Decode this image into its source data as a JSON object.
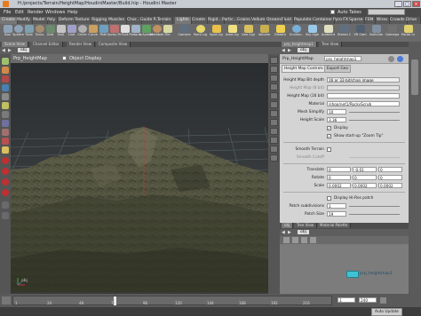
{
  "window": {
    "title": "Houdini Master",
    "title_path": "H:/projects/Terrain/HeightMap/HoudiniMaster/Build.hip - Houdini Master",
    "minimize": "_",
    "maximize": "□",
    "close": "×",
    "auto_takes": "Auto Takes"
  },
  "menubar": {
    "items": [
      "File",
      "Edit",
      "Render",
      "Windows",
      "Help"
    ]
  },
  "shelf": {
    "left_tabs": [
      "Create",
      "Modify",
      "Model",
      "Poly",
      "Deform",
      "Texture",
      "Rigging",
      "Muscles",
      "Char...",
      "Guide P...",
      "Terrain FX"
    ],
    "right_tabs": [
      "Lights",
      "Create",
      "Rigid...",
      "Partic...",
      "Grains",
      "Vellum",
      "Oceans",
      "Fluid",
      "Populate",
      "Container",
      "Pyro FX",
      "Sparse",
      "FEM",
      "Wires",
      "Crowds",
      "Drive"
    ],
    "left_tools": [
      "Box",
      "Sphere",
      "Tube",
      "Torus",
      "Grid",
      "Null",
      "Line",
      "Circle",
      "Curve",
      "Path",
      "Spray Paint",
      "Font",
      "Platonic",
      "L-System",
      "Metaball",
      "File"
    ],
    "right_tools": [
      "Camera",
      "Point Light",
      "Spot Light",
      "Area Light",
      "Geo Light",
      "Volume",
      "Distant",
      "Environ.",
      "Sky Light",
      "Ambient",
      "Stereo Cam",
      "VR Cam",
      "Switcher",
      "Gamepad",
      "Portal Light"
    ]
  },
  "left_pane": {
    "tabs": [
      "Scene View",
      "Channel Editor",
      "Render View",
      "Composite View"
    ],
    "path": "obj",
    "node_name": "Prp_HeightMap",
    "object_display": "Object Display",
    "node_label": "obj"
  },
  "params": {
    "path_tabs": [
      "prp_heightmap1",
      "Tree View"
    ],
    "path": "obj",
    "node_type": "Prp_HeightMap",
    "node_name": "prp_heightmap1",
    "tabs": [
      "Height Map Controls",
      "Export Geo"
    ],
    "rows": [
      {
        "label": "Height Map Bit depth",
        "value": "16 or 32-bit/chan image",
        "dim": false
      },
      {
        "label": "Height Map (8 bit)",
        "value": "",
        "dim": true
      },
      {
        "label": "Height Map (16 bit)",
        "value": "",
        "dim": false
      },
      {
        "label": "Material",
        "value": "/shop/net1/RockyScrub",
        "dim": false
      },
      {
        "label": "Mesh Simplify",
        "value": "10",
        "dim": false
      },
      {
        "label": "Height Scale",
        "value": "3.36",
        "dim": false
      }
    ],
    "display_label": "Display",
    "show_zoom_tip": "Show start-up \"Zoom Tip\"",
    "smooth_terrain": "Smooth Terrain",
    "smooth_cutoff": "Smooth Cutoff",
    "translate": {
      "label": "Translate",
      "x": "0",
      "y": "-0.01",
      "z": "0"
    },
    "rotate": {
      "label": "Rotate",
      "x": "0",
      "y": "0",
      "z": "0"
    },
    "scale": {
      "label": "Scale",
      "x": "0.0002",
      "y": "0.0002",
      "z": "0.0002"
    },
    "display_hires": "Display Hi-Res patch",
    "patch_subdivisions": {
      "label": "Patch subdivisions",
      "value": "1"
    },
    "patch_size": {
      "label": "Patch Size",
      "value": "19"
    }
  },
  "network": {
    "tabs": [
      "obj",
      "Tree View",
      "Material Palette"
    ],
    "path": "obj",
    "node_label": "prp_heightmap1"
  },
  "timeline": {
    "ticks": [
      "1",
      "24",
      "48",
      "72",
      "96",
      "120",
      "144",
      "168",
      "192",
      "216"
    ],
    "current_frame": "1",
    "end_frame": "240"
  },
  "status": {
    "auto_update": "Auto Update"
  },
  "colors": {
    "node_accent": "#3fc3d4",
    "selection_red": "#d83a3a"
  }
}
